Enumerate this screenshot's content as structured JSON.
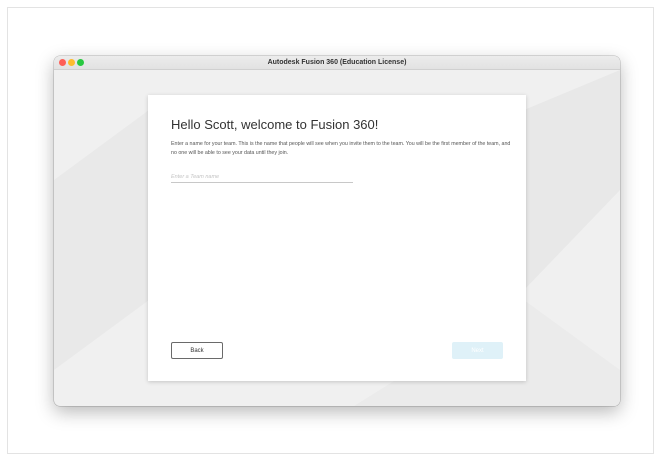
{
  "window": {
    "title": "Autodesk Fusion 360 (Education License)"
  },
  "card": {
    "heading": "Hello Scott, welcome to Fusion 360!",
    "description": "Enter a name for your team. This is the name that people will see when you invite them to the team. You will be the first member of the team, and no one will be able to see your data until they join.",
    "team_input": {
      "value": "",
      "placeholder": "Enter a Team name"
    },
    "back_label": "Back",
    "next_label": "Next"
  },
  "colors": {
    "close": "#fe5f57",
    "minimize": "#febc2e",
    "maximize": "#28c840",
    "next_disabled": "#dff1f8"
  }
}
